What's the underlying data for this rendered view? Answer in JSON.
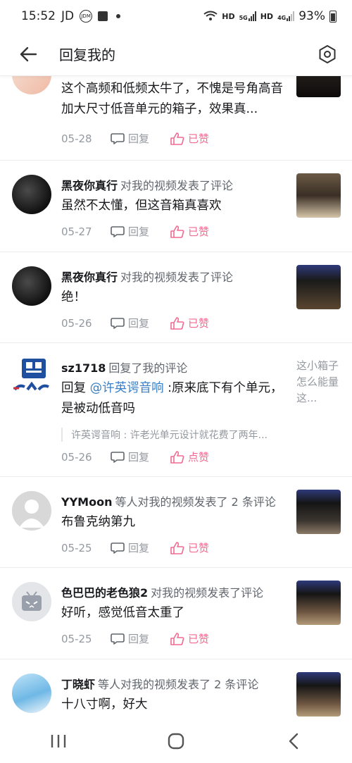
{
  "status_bar": {
    "time": "15:52",
    "carrier": "JD",
    "network_labels": [
      "HD",
      "HD"
    ],
    "net_5g": "5G",
    "net_4g": "4G",
    "battery": "93%"
  },
  "app_bar": {
    "title": "回复我的"
  },
  "comments": [
    {
      "content": "这个高频和低频太牛了，不愧是号角高音加大尺寸低音单元的箱子，效果真...",
      "date": "05-28",
      "reply_label": "回复",
      "like_label": "已赞"
    },
    {
      "username": "黑夜你真行",
      "action": "对我的视频发表了评论",
      "content": "虽然不太懂，但这音箱真喜欢",
      "date": "05-27",
      "reply_label": "回复",
      "like_label": "已赞"
    },
    {
      "username": "黑夜你真行",
      "action": "对我的视频发表了评论",
      "content": "绝！",
      "date": "05-26",
      "reply_label": "回复",
      "like_label": "已赞"
    },
    {
      "username": "sz1718",
      "action": "回复了我的评论",
      "content_prefix": "回复 ",
      "mention": "@许英谔音响",
      "content_suffix": " :原来底下有个单元，是被动低音吗",
      "quote": "许英谔音响 : 许老光单元设计就花费了两年...",
      "side_text": "这小箱子怎么能量这...",
      "date": "05-26",
      "reply_label": "回复",
      "like_label": "点赞"
    },
    {
      "username": "YYMoon",
      "action": "等人对我的视频发表了 2 条评论",
      "content": "布鲁克纳第九",
      "date": "05-25",
      "reply_label": "回复",
      "like_label": "已赞"
    },
    {
      "username": "色巴巴的老色狼2",
      "action": "对我的视频发表了评论",
      "content": "好听，感觉低音太重了",
      "date": "05-25",
      "reply_label": "回复",
      "like_label": "已赞"
    },
    {
      "username": "丁晓虾",
      "action": "等人对我的视频发表了 2 条评论",
      "content": "十八寸啊，好大"
    }
  ],
  "colors": {
    "accent_pink": "#f06c92",
    "link_blue": "#3a80c7",
    "muted": "#9499a0"
  },
  "icons": [
    "back-arrow-icon",
    "settings-hexagon-icon",
    "comment-bubble-icon",
    "thumbs-up-icon",
    "recent-apps-icon",
    "home-icon",
    "back-icon"
  ]
}
